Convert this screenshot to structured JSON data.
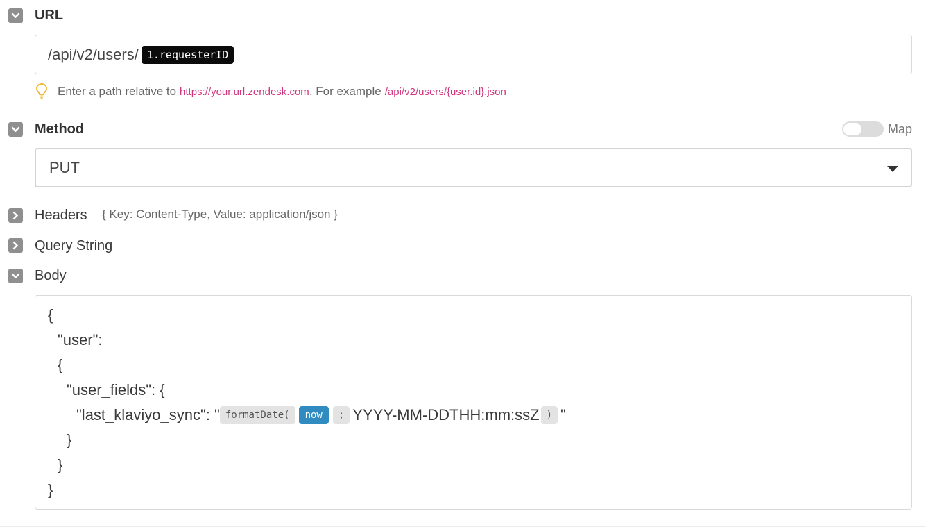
{
  "url_section": {
    "label": "URL",
    "path_prefix": "/api/v2/users/",
    "token": "1.requesterID",
    "hint_prefix": "Enter a path relative to ",
    "hint_base_url": "https://your.url.zendesk.com",
    "hint_middle": ". For example ",
    "hint_example": "/api/v2/users/{user.id}.json"
  },
  "method_section": {
    "label": "Method",
    "map_label": "Map",
    "selected": "PUT"
  },
  "headers_section": {
    "label": "Headers",
    "summary": "{ Key: Content-Type, Value: application/json }"
  },
  "query_section": {
    "label": "Query String"
  },
  "body_section": {
    "label": "Body",
    "lines": [
      "{",
      "\"user\":",
      "{",
      "\"user_fields\": {",
      "}",
      "}",
      "}"
    ],
    "sync_key": "\"last_klaviyo_sync\": \"",
    "fn_open": "formatDate(",
    "fn_arg": "now",
    "fn_sep": ";",
    "fn_format": "YYYY-MM-DDTHH:mm:ssZ",
    "fn_close": ")",
    "close_quote": "\""
  },
  "icons": {
    "expanded": "chevron-down-icon",
    "collapsed": "chevron-right-icon",
    "hint": "lightbulb-icon",
    "dropdown": "caret-down-icon"
  },
  "colors": {
    "toggle_bg": "#8f8f8f",
    "link": "#d1357f",
    "token_dark": "#0b0b0b",
    "token_blue": "#2f8bc0",
    "token_gray": "#e3e3e3"
  }
}
